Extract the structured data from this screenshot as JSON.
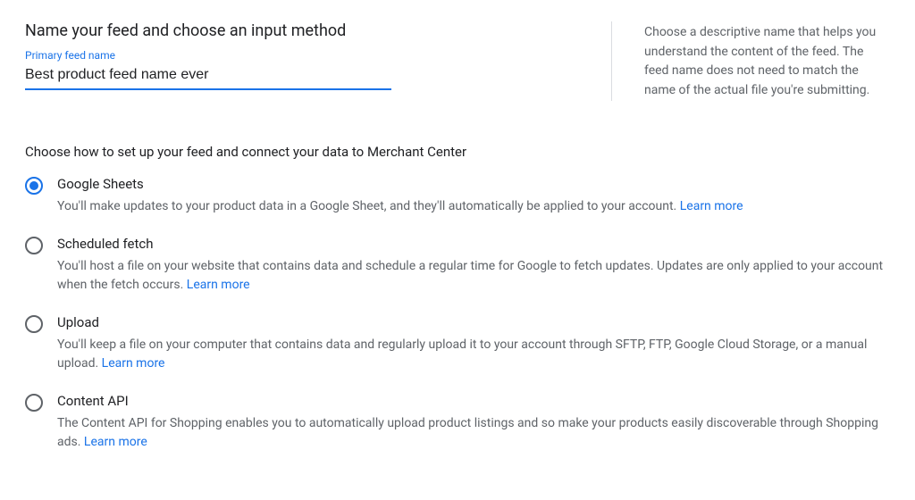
{
  "heading": "Name your feed and choose an input method",
  "feed_name": {
    "label": "Primary feed name",
    "value": "Best product feed name ever"
  },
  "help_text": "Choose a descriptive name that helps you understand the content of the feed. The feed name does not need to match the name of the actual file you're submitting.",
  "subheading": "Choose how to set up your feed and connect your data to Merchant Center",
  "learn_more_label": "Learn more",
  "colors": {
    "accent": "#1a73e8",
    "radio_unselected": "#5f6368"
  },
  "options": [
    {
      "id": "google-sheets",
      "title": "Google Sheets",
      "desc": "You'll make updates to your product data in a Google Sheet, and they'll automatically be applied to your account.",
      "selected": true,
      "has_learn_more": true
    },
    {
      "id": "scheduled-fetch",
      "title": "Scheduled fetch",
      "desc": "You'll host a file on your website that contains data and schedule a regular time for Google to fetch updates. Updates are only applied to your account when the fetch occurs.",
      "selected": false,
      "has_learn_more": true
    },
    {
      "id": "upload",
      "title": "Upload",
      "desc": "You'll keep a file on your computer that contains data and regularly upload it to your account through SFTP, FTP, Google Cloud Storage, or a manual upload.",
      "selected": false,
      "has_learn_more": true
    },
    {
      "id": "content-api",
      "title": "Content API",
      "desc": "The Content API for Shopping enables you to automatically upload product listings and so make your products easily discoverable through Shopping ads.",
      "selected": false,
      "has_learn_more": true
    }
  ]
}
